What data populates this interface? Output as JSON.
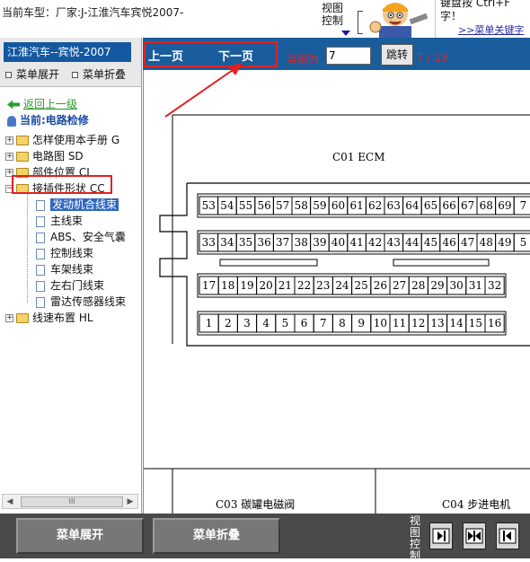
{
  "topbar": {
    "vehicle_label": "当前车型：厂家:J-江淮汽车宾悦2007-",
    "view_control_lines": [
      "视图",
      "控制"
    ],
    "hint_lines": [
      "键盘按  Ctrl+F",
      "字！"
    ],
    "menu_link": ">>菜单关键字"
  },
  "left": {
    "brand": "江淮汽车--宾悦-2007",
    "expand_menu": "菜单展开",
    "collapse_menu": "菜单折叠",
    "tree": {
      "back": "返回上一级",
      "current": "当前:电路检修",
      "items": [
        {
          "label": "怎样使用本手册 G"
        },
        {
          "label": "电路图 SD"
        },
        {
          "label": "部件位置 CL"
        },
        {
          "label": "接插件形状 CC"
        }
      ],
      "children": [
        {
          "label": "发动机合线束"
        },
        {
          "label": "主线束"
        },
        {
          "label": "ABS、安全气囊"
        },
        {
          "label": "控制线束"
        },
        {
          "label": "车架线束"
        },
        {
          "label": "左右门线束"
        },
        {
          "label": "雷达传感器线束"
        }
      ],
      "last": {
        "label": "线速布置 HL"
      }
    },
    "scroll_grip": "III"
  },
  "nav": {
    "prev": "上一页",
    "next": "下一页",
    "current_label": "当前为",
    "page_value": "7",
    "jump": "跳转",
    "count": "7 / 13"
  },
  "diagram": {
    "ecm_title": "C01  ECM",
    "row1": [
      "53",
      "54",
      "55",
      "56",
      "57",
      "58",
      "59",
      "60",
      "61",
      "62",
      "63",
      "64",
      "65",
      "66",
      "67",
      "68",
      "69",
      "7"
    ],
    "row2": [
      "33",
      "34",
      "35",
      "36",
      "37",
      "38",
      "39",
      "40",
      "41",
      "42",
      "43",
      "44",
      "45",
      "46",
      "47",
      "48",
      "49",
      "5"
    ],
    "row3": [
      "17",
      "18",
      "19",
      "20",
      "21",
      "22",
      "23",
      "24",
      "25",
      "26",
      "27",
      "28",
      "29",
      "30",
      "31",
      "32"
    ],
    "row4": [
      "1",
      "2",
      "3",
      "4",
      "5",
      "6",
      "7",
      "8",
      "9",
      "10",
      "11",
      "12",
      "13",
      "14",
      "15",
      "16"
    ],
    "c03_label": "C03  碳罐电磁阀",
    "c04_label": "C04  步进电机"
  },
  "bottom": {
    "expand": "菜单展开",
    "collapse": "菜单折叠",
    "view_lines": [
      "视",
      "图",
      "控",
      "制"
    ]
  },
  "colors": {
    "nav_blue": "#1a5d9c",
    "highlight_red": "#e32020",
    "tree_select": "#2f68c0",
    "bottom_gray": "#4a4a4a"
  }
}
